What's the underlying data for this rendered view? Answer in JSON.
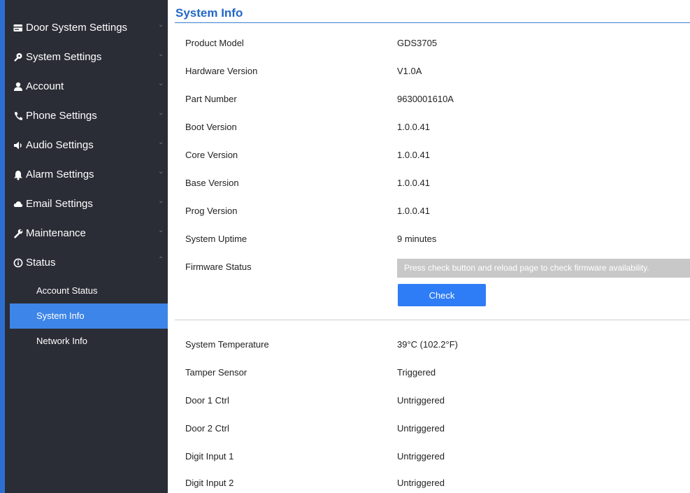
{
  "sidebar": {
    "items": [
      {
        "label": "Door System Settings",
        "icon": "card-icon",
        "chevron": "⌄"
      },
      {
        "label": "System Settings",
        "icon": "wrench-key-icon",
        "chevron": "⌄"
      },
      {
        "label": "Account",
        "icon": "user-icon",
        "chevron": "⌄"
      },
      {
        "label": "Phone Settings",
        "icon": "phone-icon",
        "chevron": "⌄"
      },
      {
        "label": "Audio Settings",
        "icon": "speaker-icon",
        "chevron": "⌄"
      },
      {
        "label": "Alarm Settings",
        "icon": "bell-icon",
        "chevron": "⌄"
      },
      {
        "label": "Email Settings",
        "icon": "cloud-icon",
        "chevron": "⌄"
      },
      {
        "label": "Maintenance",
        "icon": "wrench-icon",
        "chevron": "⌄"
      },
      {
        "label": "Status",
        "icon": "info-icon",
        "chevron": "⌃"
      }
    ],
    "sub_items": [
      {
        "label": "Account Status"
      },
      {
        "label": "System Info",
        "active": true
      },
      {
        "label": "Network Info"
      }
    ]
  },
  "page": {
    "title": "System Info",
    "rows": [
      {
        "label": "Product Model",
        "value": "GDS3705"
      },
      {
        "label": "Hardware Version",
        "value": "V1.0A"
      },
      {
        "label": "Part Number",
        "value": "9630001610A"
      },
      {
        "label": "Boot Version",
        "value": "1.0.0.41"
      },
      {
        "label": "Core Version",
        "value": "1.0.0.41"
      },
      {
        "label": "Base Version",
        "value": "1.0.0.41"
      },
      {
        "label": "Prog Version",
        "value": "1.0.0.41"
      },
      {
        "label": "System Uptime",
        "value": "9 minutes"
      },
      {
        "label": "Firmware Status",
        "value": ""
      }
    ],
    "firmware_notice": "Press check button and reload page to check firmware availability.",
    "check_button": "Check",
    "status_rows": [
      {
        "label": "System Temperature",
        "value": "39°C (102.2°F)"
      },
      {
        "label": "Tamper Sensor",
        "value": "Triggered"
      },
      {
        "label": "Door 1 Ctrl",
        "value": "Untriggered"
      },
      {
        "label": "Door 2 Ctrl",
        "value": "Untriggered"
      },
      {
        "label": "Digit Input 1",
        "value": "Untriggered"
      },
      {
        "label": "Digit Input 2",
        "value": "Untriggered"
      }
    ]
  },
  "colors": {
    "sidebar_bg": "#2a2d36",
    "active_bg": "#3d85e8",
    "accent": "#2268c6",
    "button": "#2e7cf6"
  }
}
